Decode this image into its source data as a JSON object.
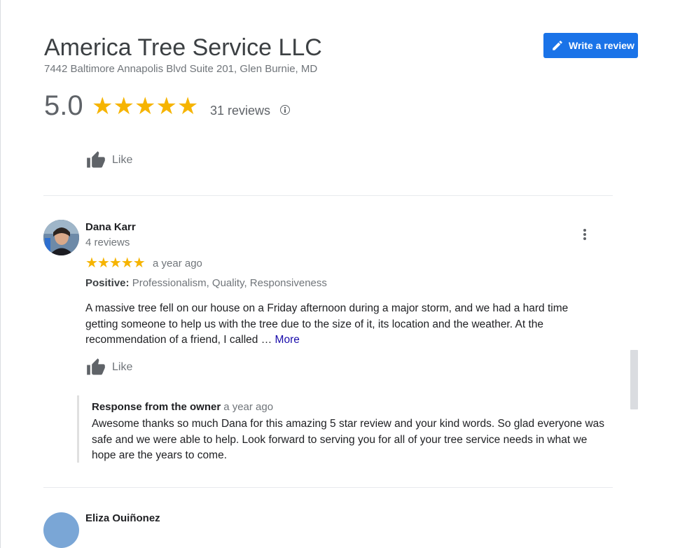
{
  "business": {
    "name": "America Tree Service LLC",
    "address": "7442 Baltimore Annapolis Blvd Suite 201, Glen Burnie, MD",
    "rating": "5.0",
    "rating_stars": "★★★★★",
    "reviews_count": "31 reviews"
  },
  "header": {
    "write_review_label": "Write a review"
  },
  "prev_review": {
    "like_label": "Like"
  },
  "review": {
    "reviewer_name": "Dana Karr",
    "reviewer_meta": "4 reviews",
    "stars": "★★★★★",
    "time": "a year ago",
    "positive_label": "Positive:",
    "positive_values": " Professionalism, Quality, Responsiveness",
    "text": "A massive tree fell on our house on a Friday afternoon during a major storm, and we had a hard time getting someone to help us with the tree due to the size of it, its location and the weather. At the recommendation of a friend, I called … ",
    "more_label": "More",
    "like_label": "Like",
    "owner_response": {
      "title": "Response from the owner",
      "time": "a year ago",
      "text": "Awesome thanks so much Dana for this amazing 5 star review and your kind words. So glad everyone was safe and we were able to help. Look forward to serving you for all of your tree service needs in what we hope are the years to come."
    }
  },
  "next_review": {
    "reviewer_name": "Eliza Quiñonez"
  },
  "colors": {
    "accent": "#1a73e8",
    "star": "#f6b400",
    "link": "#1a0dab"
  }
}
